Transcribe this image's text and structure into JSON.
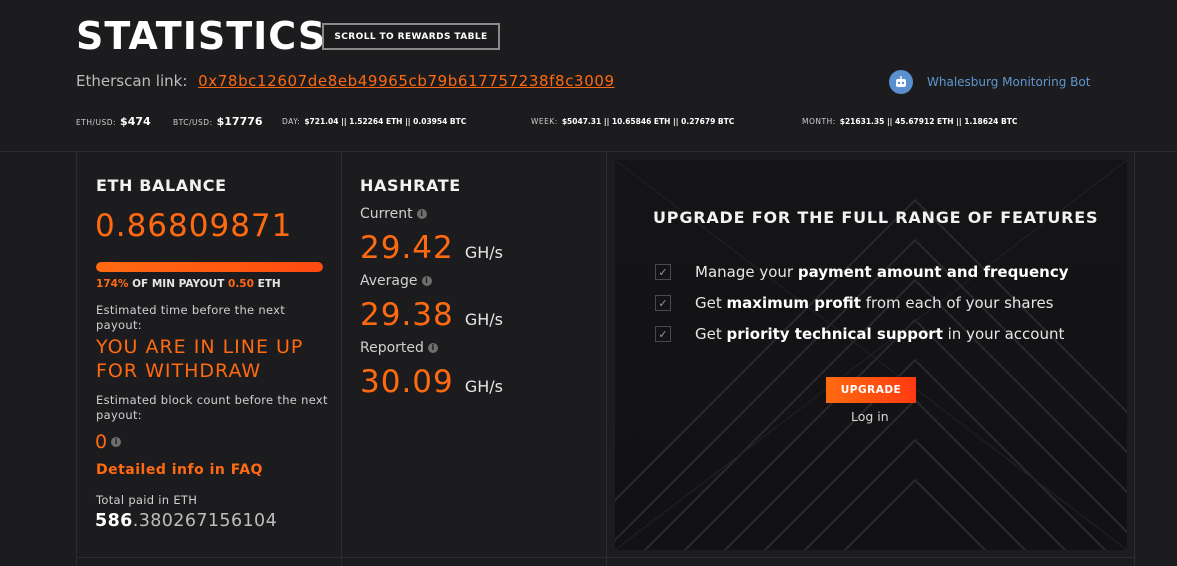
{
  "header": {
    "title": "STATISTICS",
    "scroll_button": "SCROLL TO REWARDS TABLE",
    "etherscan_label": "Etherscan link:",
    "etherscan_address": "0x78bc12607de8eb49965cb79b617757238f8c3009",
    "bot_label": "Whalesburg Monitoring Bot"
  },
  "ticker": {
    "eth_usd_label": "ETH/USD:",
    "eth_usd_value": "$474",
    "btc_usd_label": "BTC/USD:",
    "btc_usd_value": "$17776",
    "day_label": "DAY:",
    "day_value": "$721.04 || 1.52264 ETH || 0.03954 BTC",
    "week_label": "WEEK:",
    "week_value": "$5047.31 || 10.65846 ETH || 0.27679 BTC",
    "month_label": "MONTH:",
    "month_value": "$21631.35 || 45.67912 ETH || 1.18624 BTC"
  },
  "balance": {
    "heading": "ETH BALANCE",
    "value": "0.86809871",
    "progress_fraction": 1.0,
    "payout_percent": "174%",
    "payout_text": "OF MIN PAYOUT",
    "payout_min": "0.50",
    "payout_unit": "ETH",
    "est_time_label": "Estimated time before the next payout:",
    "withdraw_status": "YOU ARE IN LINE UP FOR WITHDRAW",
    "est_block_label": "Estimated block count before the next payout:",
    "block_count": "0",
    "faq_link": "Detailed info in FAQ",
    "total_paid_label": "Total paid in ETH",
    "total_paid_int": "586",
    "total_paid_dec": ".380267156104"
  },
  "hashrate": {
    "heading": "HASHRATE",
    "current_label": "Current",
    "current_value": "29.42",
    "average_label": "Average",
    "average_value": "29.38",
    "reported_label": "Reported",
    "reported_value": "30.09",
    "unit": "GH/s"
  },
  "promo": {
    "title": "UPGRADE FOR THE FULL RANGE OF FEATURES",
    "features": [
      {
        "pre": "Manage your ",
        "bold": "payment amount and frequency",
        "post": ""
      },
      {
        "pre": "Get ",
        "bold": "maximum profit",
        "post": " from each of your shares"
      },
      {
        "pre": "Get ",
        "bold": "priority technical support",
        "post": " in your account"
      }
    ],
    "upgrade_button": "UPGRADE",
    "login_link": "Log in"
  },
  "colors": {
    "accent": "#ff6a10",
    "background": "#1c1c1f",
    "link_blue": "#5f96cf"
  }
}
